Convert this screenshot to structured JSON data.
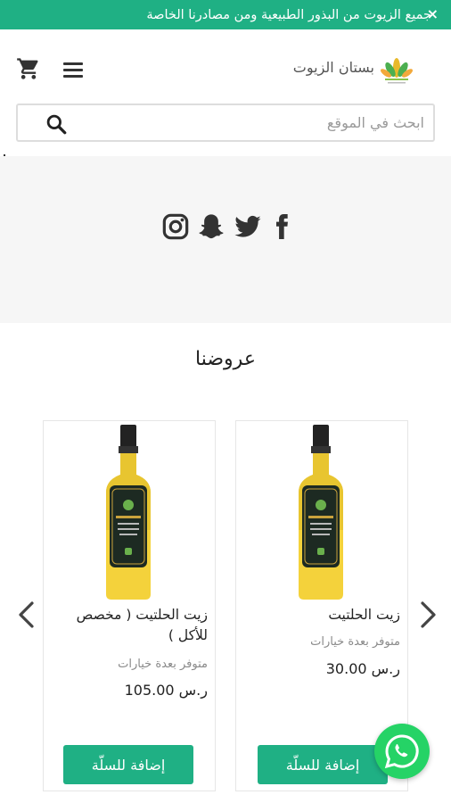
{
  "announcement": {
    "text": "جميع الزيوت من البذور الطبيعية ومن مصادرنا الخاصة",
    "close_label": "×"
  },
  "header": {
    "store_name": "بستان الزيوت",
    "logo_text": "",
    "cart_icon": "cart-icon",
    "menu_icon": "hamburger-menu-icon"
  },
  "search": {
    "placeholder": "ابحث في الموقع",
    "value": "",
    "icon": "search-icon"
  },
  "social": [
    "facebook-icon",
    "twitter-icon",
    "snapchat-icon",
    "instagram-icon"
  ],
  "offers": {
    "title": "عروضنا",
    "products": [
      {
        "name": "زيت الحلتيت",
        "options": "متوفر بعدة خيارات",
        "price": "ر.س 30.00",
        "button": "إضافة للسلّة"
      },
      {
        "name": "زيت الحلتيت ( مخصص للأكل )",
        "options": "متوفر بعدة خيارات",
        "price": "ر.س 105.00",
        "button": "إضافة للسلّة"
      }
    ]
  },
  "colors": {
    "brand": "#1fb084",
    "whatsapp": "#25d366"
  }
}
